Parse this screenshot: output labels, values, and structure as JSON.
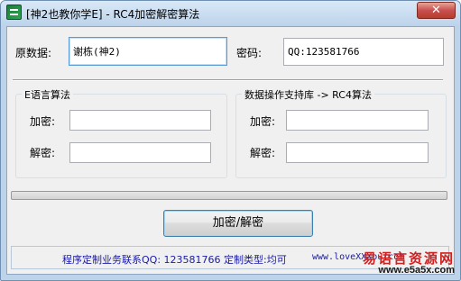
{
  "window": {
    "title": "[神2也教你学E] - RC4加密解密算法",
    "close_glyph": "✕"
  },
  "top": {
    "source_label": "原数据:",
    "source_value": "谢栋(神2)",
    "password_label": "密码:",
    "password_value": "QQ:123581766"
  },
  "group_e": {
    "title": "E语言算法",
    "encrypt_label": "加密:",
    "encrypt_value": "",
    "decrypt_label": "解密:",
    "decrypt_value": ""
  },
  "group_lib": {
    "title": "数据操作支持库 -> RC4算法",
    "encrypt_label": "加密:",
    "encrypt_value": "",
    "decrypt_label": "解密:",
    "decrypt_value": ""
  },
  "progress": {
    "fraction": 0.0
  },
  "action_button": "加密/解密",
  "status": {
    "text": "程序定制业务联系QQ: 123581766 定制类型:均可",
    "url": "www.loveXXXou.com"
  },
  "watermark": {
    "line1": "易语言资源网",
    "line2": "www.e5a5x.com"
  }
}
